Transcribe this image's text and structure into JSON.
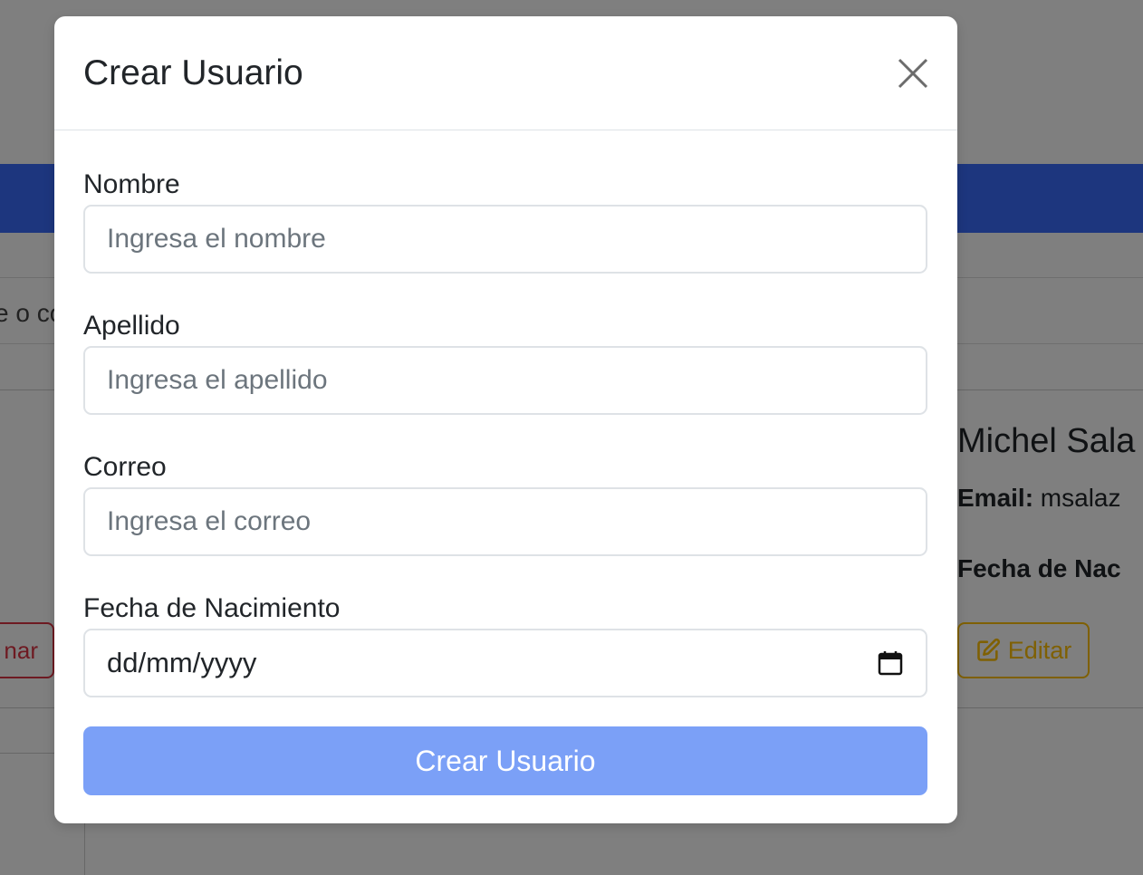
{
  "background": {
    "search_text": "e o co",
    "delete_button_label": "nar",
    "user_card": {
      "name": "Michel Sala",
      "email_label": "Email:",
      "email_value": " msalaz",
      "birth_label": "Fecha de Nac",
      "edit_button_label": "Editar"
    }
  },
  "modal": {
    "title": "Crear Usuario",
    "fields": {
      "nombre": {
        "label": "Nombre",
        "placeholder": "Ingresa el nombre",
        "value": ""
      },
      "apellido": {
        "label": "Apellido",
        "placeholder": "Ingresa el apellido",
        "value": ""
      },
      "correo": {
        "label": "Correo",
        "placeholder": "Ingresa el correo",
        "value": ""
      },
      "fecha": {
        "label": "Fecha de Nacimiento",
        "display": "dd/mm/yyyy"
      }
    },
    "submit_label": "Crear Usuario"
  },
  "colors": {
    "primary_disabled": "#7ba0f7",
    "navbar": "#3a6dfd",
    "danger": "#dc3545",
    "warning": "#ffc107",
    "backdrop": "rgba(0,0,0,0.5)"
  },
  "icons": {
    "close": "close-icon",
    "calendar": "calendar-icon",
    "edit": "edit-icon"
  }
}
